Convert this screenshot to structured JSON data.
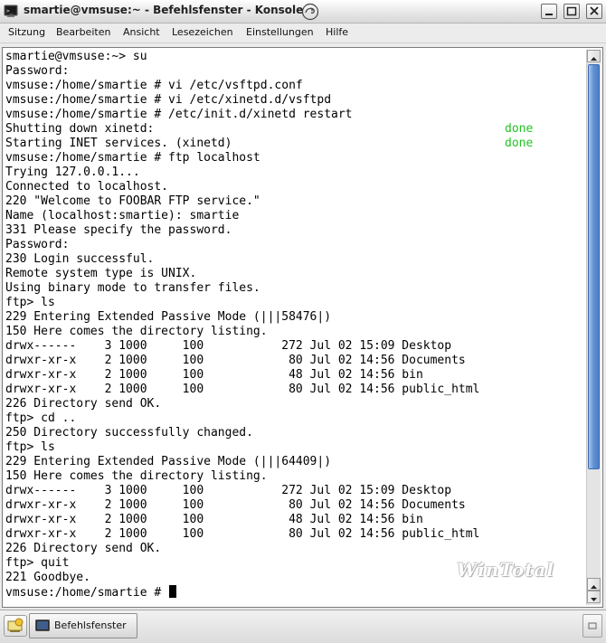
{
  "window": {
    "title": "smartie@vmsuse:~ - Befehlsfenster - Konsole",
    "buttons": [
      "minimize",
      "maximize",
      "close"
    ]
  },
  "menubar": {
    "items": [
      "Sitzung",
      "Bearbeiten",
      "Ansicht",
      "Lesezeichen",
      "Einstellungen",
      "Hilfe"
    ]
  },
  "terminal": {
    "lines": [
      "smartie@vmsuse:~> su",
      "Password:",
      "vmsuse:/home/smartie # vi /etc/vsftpd.conf",
      "vmsuse:/home/smartie # vi /etc/xinetd.d/vsftpd",
      "vmsuse:/home/smartie # /etc/init.d/xinetd restart",
      "Shutting down xinetd:",
      "Starting INET services. (xinetd)",
      "vmsuse:/home/smartie # ftp localhost",
      "Trying 127.0.0.1...",
      "Connected to localhost.",
      "220 \"Welcome to FOOBAR FTP service.\"",
      "Name (localhost:smartie): smartie",
      "331 Please specify the password.",
      "Password:",
      "230 Login successful.",
      "Remote system type is UNIX.",
      "Using binary mode to transfer files.",
      "ftp> ls",
      "229 Entering Extended Passive Mode (|||58476|)",
      "150 Here comes the directory listing.",
      "drwx------    3 1000     100           272 Jul 02 15:09 Desktop",
      "drwxr-xr-x    2 1000     100            80 Jul 02 14:56 Documents",
      "drwxr-xr-x    2 1000     100            48 Jul 02 14:56 bin",
      "drwxr-xr-x    2 1000     100            80 Jul 02 14:56 public_html",
      "226 Directory send OK.",
      "ftp> cd ..",
      "250 Directory successfully changed.",
      "ftp> ls",
      "229 Entering Extended Passive Mode (|||64409|)",
      "150 Here comes the directory listing.",
      "drwx------    3 1000     100           272 Jul 02 15:09 Desktop",
      "drwxr-xr-x    2 1000     100            80 Jul 02 14:56 Documents",
      "drwxr-xr-x    2 1000     100            48 Jul 02 14:56 bin",
      "drwxr-xr-x    2 1000     100            80 Jul 02 14:56 public_html",
      "226 Directory send OK.",
      "ftp> quit",
      "221 Goodbye.",
      "vmsuse:/home/smartie # "
    ],
    "status_done_1": "done",
    "status_done_2": "done",
    "status_color": "#22c422",
    "watermark": "WinTotal"
  },
  "taskbar": {
    "task_label": "Befehlsfenster"
  }
}
